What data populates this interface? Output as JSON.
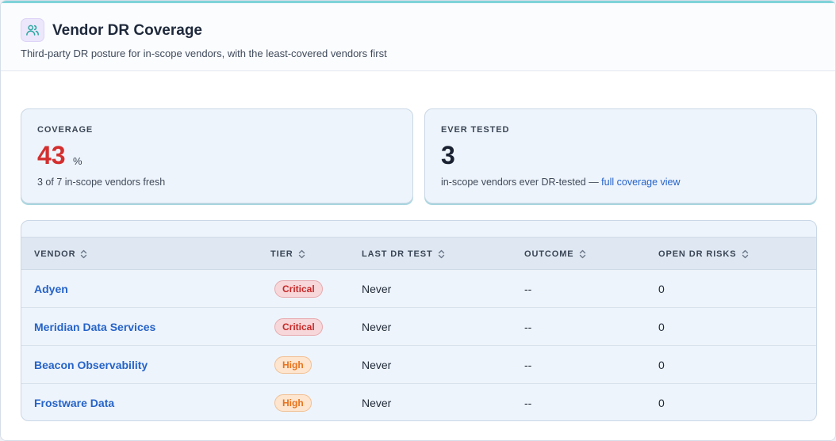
{
  "header": {
    "title": "Vendor DR Coverage",
    "subtitle": "Third-party DR posture for in-scope vendors, with the least-covered vendors first",
    "icon": "users-icon"
  },
  "cards": {
    "coverage": {
      "label": "COVERAGE",
      "value": "43",
      "unit": "%",
      "note": "3 of 7 in-scope vendors fresh",
      "value_color": "#d32f2f"
    },
    "ever_tested": {
      "label": "EVER TESTED",
      "value": "3",
      "note": "in-scope vendors ever DR-tested — ",
      "link": "full coverage view"
    }
  },
  "table": {
    "columns": {
      "vendor": "VENDOR",
      "tier": "TIER",
      "last_dr_test": "LAST DR TEST",
      "outcome": "OUTCOME",
      "open_dr_risks": "OPEN DR RISKS"
    },
    "rows": [
      {
        "vendor": "Adyen",
        "tier": "Critical",
        "last_dr_test": "Never",
        "outcome": "--",
        "open_dr_risks": "0"
      },
      {
        "vendor": "Meridian Data Services",
        "tier": "Critical",
        "last_dr_test": "Never",
        "outcome": "--",
        "open_dr_risks": "0"
      },
      {
        "vendor": "Beacon Observability",
        "tier": "High",
        "last_dr_test": "Never",
        "outcome": "--",
        "open_dr_risks": "0"
      },
      {
        "vendor": "Frostware Data",
        "tier": "High",
        "last_dr_test": "Never",
        "outcome": "--",
        "open_dr_risks": "0"
      }
    ]
  },
  "colors": {
    "accent": "#7fd3d8",
    "link": "#2563c9",
    "critical": "#c62828",
    "high": "#e8721c"
  }
}
